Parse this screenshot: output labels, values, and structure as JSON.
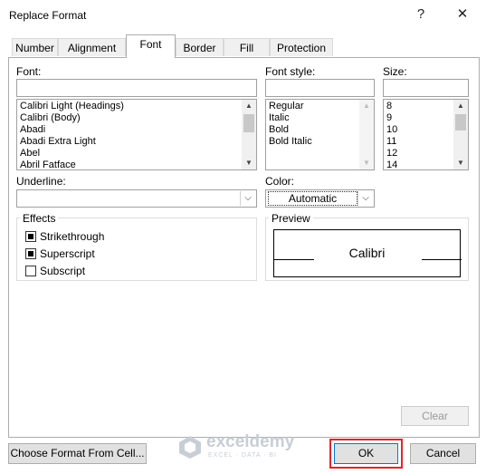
{
  "dialog": {
    "title": "Replace Format",
    "help_glyph": "?",
    "close_glyph": "✕"
  },
  "tabs": [
    {
      "label": "Number"
    },
    {
      "label": "Alignment"
    },
    {
      "label": "Font"
    },
    {
      "label": "Border"
    },
    {
      "label": "Fill"
    },
    {
      "label": "Protection"
    }
  ],
  "active_tab": "Font",
  "font": {
    "label": "Font:",
    "value": "",
    "items": [
      "Calibri Light (Headings)",
      "Calibri (Body)",
      "Abadi",
      "Abadi Extra Light",
      "Abel",
      "Abril Fatface"
    ]
  },
  "font_style": {
    "label": "Font style:",
    "value": "",
    "items": [
      "Regular",
      "Italic",
      "Bold",
      "Bold Italic"
    ]
  },
  "size": {
    "label": "Size:",
    "value": "",
    "items": [
      "8",
      "9",
      "10",
      "11",
      "12",
      "14"
    ]
  },
  "underline": {
    "label": "Underline:",
    "value": ""
  },
  "color": {
    "label": "Color:",
    "value": "Automatic"
  },
  "effects": {
    "label": "Effects",
    "items": [
      {
        "label": "Strikethrough",
        "checked": true
      },
      {
        "label": "Superscript",
        "checked": true
      },
      {
        "label": "Subscript",
        "checked": false
      }
    ]
  },
  "preview": {
    "label": "Preview",
    "sample": "Calibri"
  },
  "buttons": {
    "clear": "Clear",
    "choose_format": "Choose Format From Cell...",
    "ok": "OK",
    "cancel": "Cancel"
  },
  "watermark": {
    "name": "exceldemy",
    "tagline": "EXCEL · DATA · BI"
  },
  "colors": {
    "ok_highlight": "#e0262b",
    "watermark": "#c9ced6"
  }
}
